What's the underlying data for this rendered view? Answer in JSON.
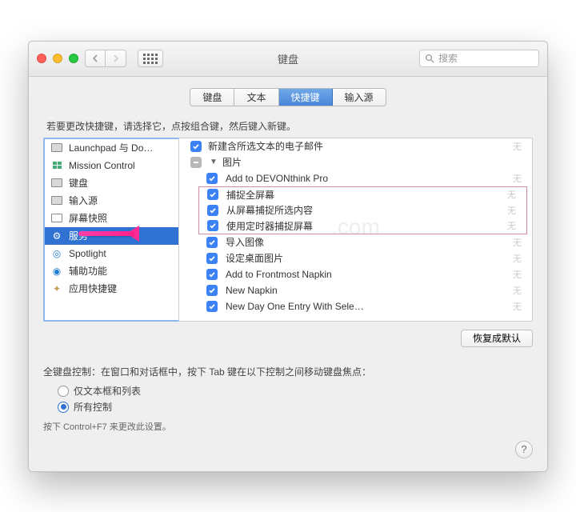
{
  "window": {
    "title": "键盘"
  },
  "search": {
    "placeholder": "搜索"
  },
  "tabs": [
    {
      "label": "键盘",
      "active": false
    },
    {
      "label": "文本",
      "active": false
    },
    {
      "label": "快捷键",
      "active": true
    },
    {
      "label": "输入源",
      "active": false
    }
  ],
  "hint": "若要更改快捷键，请选择它，点按组合键，然后键入新键。",
  "sidebar": {
    "items": [
      {
        "label": "Launchpad 与 Do…",
        "icon": "launchpad",
        "selected": false
      },
      {
        "label": "Mission Control",
        "icon": "mission-control",
        "selected": false
      },
      {
        "label": "键盘",
        "icon": "keyboard",
        "selected": false
      },
      {
        "label": "输入源",
        "icon": "input-source",
        "selected": false
      },
      {
        "label": "屏幕快照",
        "icon": "screenshot",
        "selected": false
      },
      {
        "label": "服务",
        "icon": "gear",
        "selected": true
      },
      {
        "label": "Spotlight",
        "icon": "spotlight",
        "selected": false
      },
      {
        "label": "辅助功能",
        "icon": "accessibility",
        "selected": false
      },
      {
        "label": "应用快捷键",
        "icon": "app-shortcuts",
        "selected": false
      }
    ]
  },
  "shortcuts": [
    {
      "label": "新建含所选文本的电子邮件",
      "checked": true,
      "kind": "item",
      "none": "无"
    },
    {
      "label": "图片",
      "checked": "mixed",
      "kind": "group",
      "disclosure": true
    },
    {
      "label": "Add to DEVONthink Pro",
      "checked": true,
      "kind": "item",
      "indent": true,
      "none": "无"
    },
    {
      "label": "捕捉全屏幕",
      "checked": true,
      "kind": "item",
      "indent": true,
      "none": "无",
      "boxTop": true
    },
    {
      "label": "从屏幕捕捉所选内容",
      "checked": true,
      "kind": "item",
      "indent": true,
      "none": "无"
    },
    {
      "label": "使用定时器捕捉屏幕",
      "checked": true,
      "kind": "item",
      "indent": true,
      "none": "无",
      "boxBottom": true
    },
    {
      "label": "导入图像",
      "checked": true,
      "kind": "item",
      "indent": true,
      "none": "无"
    },
    {
      "label": "设定桌面图片",
      "checked": true,
      "kind": "item",
      "indent": true,
      "none": "无"
    },
    {
      "label": "Add to Frontmost Napkin",
      "checked": true,
      "kind": "item",
      "indent": true,
      "none": "无"
    },
    {
      "label": "New Napkin",
      "checked": true,
      "kind": "item",
      "indent": true,
      "none": "无"
    },
    {
      "label": "New Day One Entry With Sele…",
      "checked": true,
      "kind": "item",
      "indent": true,
      "none": "无"
    }
  ],
  "restoreDefaults": "恢复成默认",
  "kbdControl": {
    "heading": "全键盘控制：在窗口和对话框中，按下 Tab 键在以下控制之间移动键盘焦点：",
    "options": [
      {
        "label": "仅文本框和列表",
        "selected": false
      },
      {
        "label": "所有控制",
        "selected": true
      }
    ],
    "note": "按下 Control+F7 来更改此设置。"
  }
}
